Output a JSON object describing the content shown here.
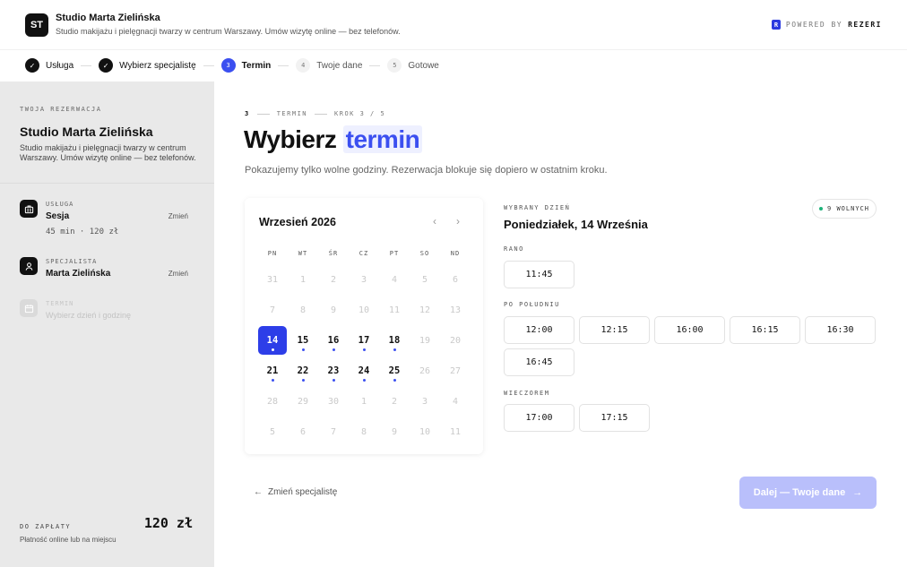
{
  "header": {
    "logo": "ST",
    "brand_name": "Studio Marta Zielińska",
    "brand_desc": "Studio makijażu i pielęgnacji twarzy w centrum Warszawy. Umów wizytę online — bez telefonów.",
    "powered_prefix": "POWERED BY",
    "powered_brand": "REZERI",
    "powered_mark": "R"
  },
  "stepper": {
    "steps": [
      {
        "num": "✓",
        "label": "Usługa",
        "state": "done"
      },
      {
        "num": "✓",
        "label": "Wybierz specjalistę",
        "state": "done"
      },
      {
        "num": "3",
        "label": "Termin",
        "state": "active"
      },
      {
        "num": "4",
        "label": "Twoje dane",
        "state": "todo"
      },
      {
        "num": "5",
        "label": "Gotowe",
        "state": "todo"
      }
    ]
  },
  "sidebar": {
    "eyebrow": "TWOJA REZERWACJA",
    "title": "Studio Marta Zielińska",
    "desc": "Studio makijażu i pielęgnacji twarzy w centrum Warszawy. Umów wizytę online — bez telefonów.",
    "service": {
      "label": "USŁUGA",
      "value": "Sesja",
      "sub": "45 min · 120 zł",
      "change": "Zmień"
    },
    "specialist": {
      "label": "SPECJALISTA",
      "value": "Marta Zielińska",
      "change": "Zmień"
    },
    "term": {
      "label": "TERMIN",
      "value": "Wybierz dzień i godzinę"
    },
    "payment": {
      "label": "DO ZAPŁATY",
      "amount": "120 zł",
      "note": "Płatność online lub na miejscu"
    }
  },
  "main": {
    "crumbs": {
      "num": "3",
      "section": "TERMIN",
      "step": "KROK 3 / 5"
    },
    "title_prefix": "Wybierz",
    "title_highlight": "termin",
    "lead": "Pokazujemy tylko wolne godziny. Rezerwacja blokuje się dopiero w ostatnim kroku."
  },
  "calendar": {
    "month": "Wrzesień 2026",
    "prev": "‹",
    "next": "›",
    "weekdays": [
      "PN",
      "WT",
      "ŚR",
      "CZ",
      "PT",
      "SO",
      "ND"
    ],
    "days": [
      {
        "d": "31",
        "s": "off"
      },
      {
        "d": "1",
        "s": "off"
      },
      {
        "d": "2",
        "s": "off"
      },
      {
        "d": "3",
        "s": "off"
      },
      {
        "d": "4",
        "s": "off"
      },
      {
        "d": "5",
        "s": "off"
      },
      {
        "d": "6",
        "s": "off"
      },
      {
        "d": "7",
        "s": "off"
      },
      {
        "d": "8",
        "s": "off"
      },
      {
        "d": "9",
        "s": "off"
      },
      {
        "d": "10",
        "s": "off"
      },
      {
        "d": "11",
        "s": "off"
      },
      {
        "d": "12",
        "s": "off"
      },
      {
        "d": "13",
        "s": "off"
      },
      {
        "d": "14",
        "s": "selected"
      },
      {
        "d": "15",
        "s": "avail"
      },
      {
        "d": "16",
        "s": "avail"
      },
      {
        "d": "17",
        "s": "avail"
      },
      {
        "d": "18",
        "s": "avail"
      },
      {
        "d": "19",
        "s": "off"
      },
      {
        "d": "20",
        "s": "off"
      },
      {
        "d": "21",
        "s": "avail"
      },
      {
        "d": "22",
        "s": "avail"
      },
      {
        "d": "23",
        "s": "avail"
      },
      {
        "d": "24",
        "s": "avail"
      },
      {
        "d": "25",
        "s": "avail"
      },
      {
        "d": "26",
        "s": "off"
      },
      {
        "d": "27",
        "s": "off"
      },
      {
        "d": "28",
        "s": "off"
      },
      {
        "d": "29",
        "s": "off"
      },
      {
        "d": "30",
        "s": "off"
      },
      {
        "d": "1",
        "s": "off"
      },
      {
        "d": "2",
        "s": "off"
      },
      {
        "d": "3",
        "s": "off"
      },
      {
        "d": "4",
        "s": "off"
      },
      {
        "d": "5",
        "s": "off"
      },
      {
        "d": "6",
        "s": "off"
      },
      {
        "d": "7",
        "s": "off"
      },
      {
        "d": "8",
        "s": "off"
      },
      {
        "d": "9",
        "s": "off"
      },
      {
        "d": "10",
        "s": "off"
      },
      {
        "d": "11",
        "s": "off"
      }
    ]
  },
  "times": {
    "selected_label": "WYBRANY DZIEŃ",
    "selected_day": "Poniedziałek, 14 Września",
    "free_badge": "9 WOLNYCH",
    "morning": {
      "label": "RANO",
      "slots": [
        "11:45"
      ]
    },
    "afternoon": {
      "label": "PO POŁUDNIU",
      "slots": [
        "12:00",
        "12:15",
        "16:00",
        "16:15",
        "16:30",
        "16:45"
      ]
    },
    "evening": {
      "label": "WIECZOREM",
      "slots": [
        "17:00",
        "17:15"
      ]
    }
  },
  "actions": {
    "back": "Zmień specjalistę",
    "back_arrow": "←",
    "next": "Dalej — Twoje dane",
    "next_arrow": "→"
  },
  "colors": {
    "accent": "#3b4ff0",
    "free_dot": "#1db37a",
    "next_disabled": "#b9bffb"
  }
}
